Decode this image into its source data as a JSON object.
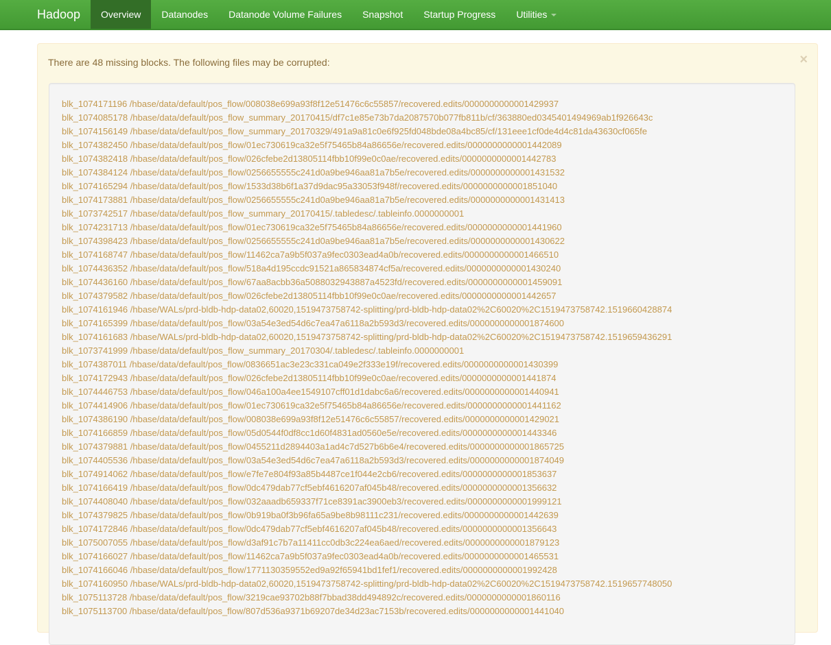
{
  "navbar": {
    "brand": "Hadoop",
    "items": [
      {
        "label": "Overview",
        "active": true
      },
      {
        "label": "Datanodes",
        "active": false
      },
      {
        "label": "Datanode Volume Failures",
        "active": false
      },
      {
        "label": "Snapshot",
        "active": false
      },
      {
        "label": "Startup Progress",
        "active": false
      },
      {
        "label": "Utilities",
        "active": false,
        "dropdown": true
      }
    ]
  },
  "alert": {
    "message": "There are 48 missing blocks. The following files may be corrupted:",
    "close_symbol": "×"
  },
  "corrupted_files": [
    "blk_1074171196 /hbase/data/default/pos_flow/008038e699a93f8f12e51476c6c55857/recovered.edits/0000000000001429937",
    "blk_1074085178 /hbase/data/default/pos_flow_summary_20170415/df7c1e85e73b7da2087570b077fb811b/cf/363880ed0345401494969ab1f926643c",
    "blk_1074156149 /hbase/data/default/pos_flow_summary_20170329/491a9a81c0e6f925fd048bde08a4bc85/cf/131eee1cf0de4d4c81da43630cf065fe",
    "blk_1074382450 /hbase/data/default/pos_flow/01ec730619ca32e5f75465b84a86656e/recovered.edits/0000000000001442089",
    "blk_1074382418 /hbase/data/default/pos_flow/026cfebe2d13805114fbb10f99e0c0ae/recovered.edits/0000000000001442783",
    "blk_1074384124 /hbase/data/default/pos_flow/0256655555c241d0a9be946aa81a7b5e/recovered.edits/0000000000001431532",
    "blk_1074165294 /hbase/data/default/pos_flow/1533d38b6f1a37d9dac95a33053f948f/recovered.edits/0000000000001851040",
    "blk_1074173881 /hbase/data/default/pos_flow/0256655555c241d0a9be946aa81a7b5e/recovered.edits/0000000000001431413",
    "blk_1073742517 /hbase/data/default/pos_flow_summary_20170415/.tabledesc/.tableinfo.0000000001",
    "blk_1074231713 /hbase/data/default/pos_flow/01ec730619ca32e5f75465b84a86656e/recovered.edits/0000000000001441960",
    "blk_1074398423 /hbase/data/default/pos_flow/0256655555c241d0a9be946aa81a7b5e/recovered.edits/0000000000001430622",
    "blk_1074168747 /hbase/data/default/pos_flow/11462ca7a9b5f037a9fec0303ead4a0b/recovered.edits/0000000000001466510",
    "blk_1074436352 /hbase/data/default/pos_flow/518a4d195ccdc91521a865834874cf5a/recovered.edits/0000000000001430240",
    "blk_1074436160 /hbase/data/default/pos_flow/67aa8acbb36a5088032943887a4523fd/recovered.edits/0000000000001459091",
    "blk_1074379582 /hbase/data/default/pos_flow/026cfebe2d13805114fbb10f99e0c0ae/recovered.edits/0000000000001442657",
    "blk_1074161946 /hbase/WALs/prd-bldb-hdp-data02,60020,1519473758742-splitting/prd-bldb-hdp-data02%2C60020%2C1519473758742.1519660428874",
    "blk_1074165399 /hbase/data/default/pos_flow/03a54e3ed54d6c7ea47a6118a2b593d3/recovered.edits/0000000000001874600",
    "blk_1074161683 /hbase/WALs/prd-bldb-hdp-data02,60020,1519473758742-splitting/prd-bldb-hdp-data02%2C60020%2C1519473758742.1519659436291",
    "blk_1073741999 /hbase/data/default/pos_flow_summary_20170304/.tabledesc/.tableinfo.0000000001",
    "blk_1074387011 /hbase/data/default/pos_flow/0836651ac3e23c331ca049e2f333e19f/recovered.edits/0000000000001430399",
    "blk_1074172943 /hbase/data/default/pos_flow/026cfebe2d13805114fbb10f99e0c0ae/recovered.edits/0000000000001441874",
    "blk_1074446753 /hbase/data/default/pos_flow/046a100a4ee1549107cff01d1dabc6a6/recovered.edits/0000000000001440941",
    "blk_1074414906 /hbase/data/default/pos_flow/01ec730619ca32e5f75465b84a86656e/recovered.edits/0000000000001441162",
    "blk_1074386190 /hbase/data/default/pos_flow/008038e699a93f8f12e51476c6c55857/recovered.edits/0000000000001429021",
    "blk_1074166859 /hbase/data/default/pos_flow/05d0544f0df8cc1d60f4831ad0560e5e/recovered.edits/0000000000001443346",
    "blk_1074379881 /hbase/data/default/pos_flow/0455211d2894403a1ad4c7d527b6b6e4/recovered.edits/0000000000001865725",
    "blk_1074405536 /hbase/data/default/pos_flow/03a54e3ed54d6c7ea47a6118a2b593d3/recovered.edits/0000000000001874049",
    "blk_1074914062 /hbase/data/default/pos_flow/e7fe7e804f93a85b4487ce1f044e2cb6/recovered.edits/0000000000001853637",
    "blk_1074166419 /hbase/data/default/pos_flow/0dc479dab77cf5ebf4616207af045b48/recovered.edits/0000000000001356632",
    "blk_1074408040 /hbase/data/default/pos_flow/032aaadb659337f71ce8391ac3900eb3/recovered.edits/0000000000001999121",
    "blk_1074379825 /hbase/data/default/pos_flow/0b919ba0f3b96fa65a9be8b98111c231/recovered.edits/0000000000001442639",
    "blk_1074172846 /hbase/data/default/pos_flow/0dc479dab77cf5ebf4616207af045b48/recovered.edits/0000000000001356643",
    "blk_1075007055 /hbase/data/default/pos_flow/d3af91c7b7a11411cc0db3c224ea6aed/recovered.edits/0000000000001879123",
    "blk_1074166027 /hbase/data/default/pos_flow/11462ca7a9b5f037a9fec0303ead4a0b/recovered.edits/0000000000001465531",
    "blk_1074166046 /hbase/data/default/pos_flow/1771130359552ed9a92f65941bd1fef1/recovered.edits/0000000000001992428",
    "blk_1074160950 /hbase/WALs/prd-bldb-hdp-data02,60020,1519473758742-splitting/prd-bldb-hdp-data02%2C60020%2C1519473758742.1519657748050",
    "blk_1075113728 /hbase/data/default/pos_flow/3219cae93702b88f7bbad38dd494892c/recovered.edits/0000000000001860116",
    "blk_1075113700 /hbase/data/default/pos_flow/807d536a9371b69207de34d23ac7153b/recovered.edits/0000000000001441040"
  ],
  "colors": {
    "navbar": "#4aa13a",
    "navbar_active": "#336e27",
    "alert_bg": "#fcf8e3",
    "alert_text": "#8a6d3b",
    "file_link": "#c3994f"
  }
}
